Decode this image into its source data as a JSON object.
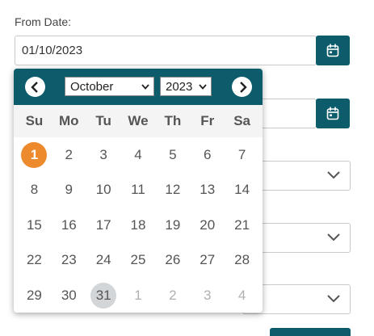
{
  "form": {
    "from_date_label": "From Date:",
    "from_date_value": "01/10/2023"
  },
  "datepicker": {
    "month": "October",
    "year": "2023",
    "weekdays": [
      "Su",
      "Mo",
      "Tu",
      "We",
      "Th",
      "Fr",
      "Sa"
    ],
    "weeks": [
      [
        {
          "d": "1",
          "state": "selected"
        },
        {
          "d": "2"
        },
        {
          "d": "3"
        },
        {
          "d": "4"
        },
        {
          "d": "5"
        },
        {
          "d": "6"
        },
        {
          "d": "7"
        }
      ],
      [
        {
          "d": "8"
        },
        {
          "d": "9"
        },
        {
          "d": "10"
        },
        {
          "d": "11"
        },
        {
          "d": "12"
        },
        {
          "d": "13"
        },
        {
          "d": "14"
        }
      ],
      [
        {
          "d": "15"
        },
        {
          "d": "16"
        },
        {
          "d": "17"
        },
        {
          "d": "18"
        },
        {
          "d": "19"
        },
        {
          "d": "20"
        },
        {
          "d": "21"
        }
      ],
      [
        {
          "d": "22"
        },
        {
          "d": "23"
        },
        {
          "d": "24"
        },
        {
          "d": "25"
        },
        {
          "d": "26"
        },
        {
          "d": "27"
        },
        {
          "d": "28"
        }
      ],
      [
        {
          "d": "29"
        },
        {
          "d": "30"
        },
        {
          "d": "31",
          "state": "hover"
        },
        {
          "d": "1",
          "state": "other"
        },
        {
          "d": "2",
          "state": "other"
        },
        {
          "d": "3",
          "state": "other"
        },
        {
          "d": "4",
          "state": "other"
        }
      ]
    ]
  },
  "colors": {
    "header": "#0d5c6b",
    "selected": "#ee8a2e",
    "hover": "#d3d6d9"
  },
  "icons": {
    "prev": "chevron-left-icon",
    "next": "chevron-right-icon",
    "calendar": "calendar-icon",
    "dropdown": "chevron-down-icon"
  }
}
